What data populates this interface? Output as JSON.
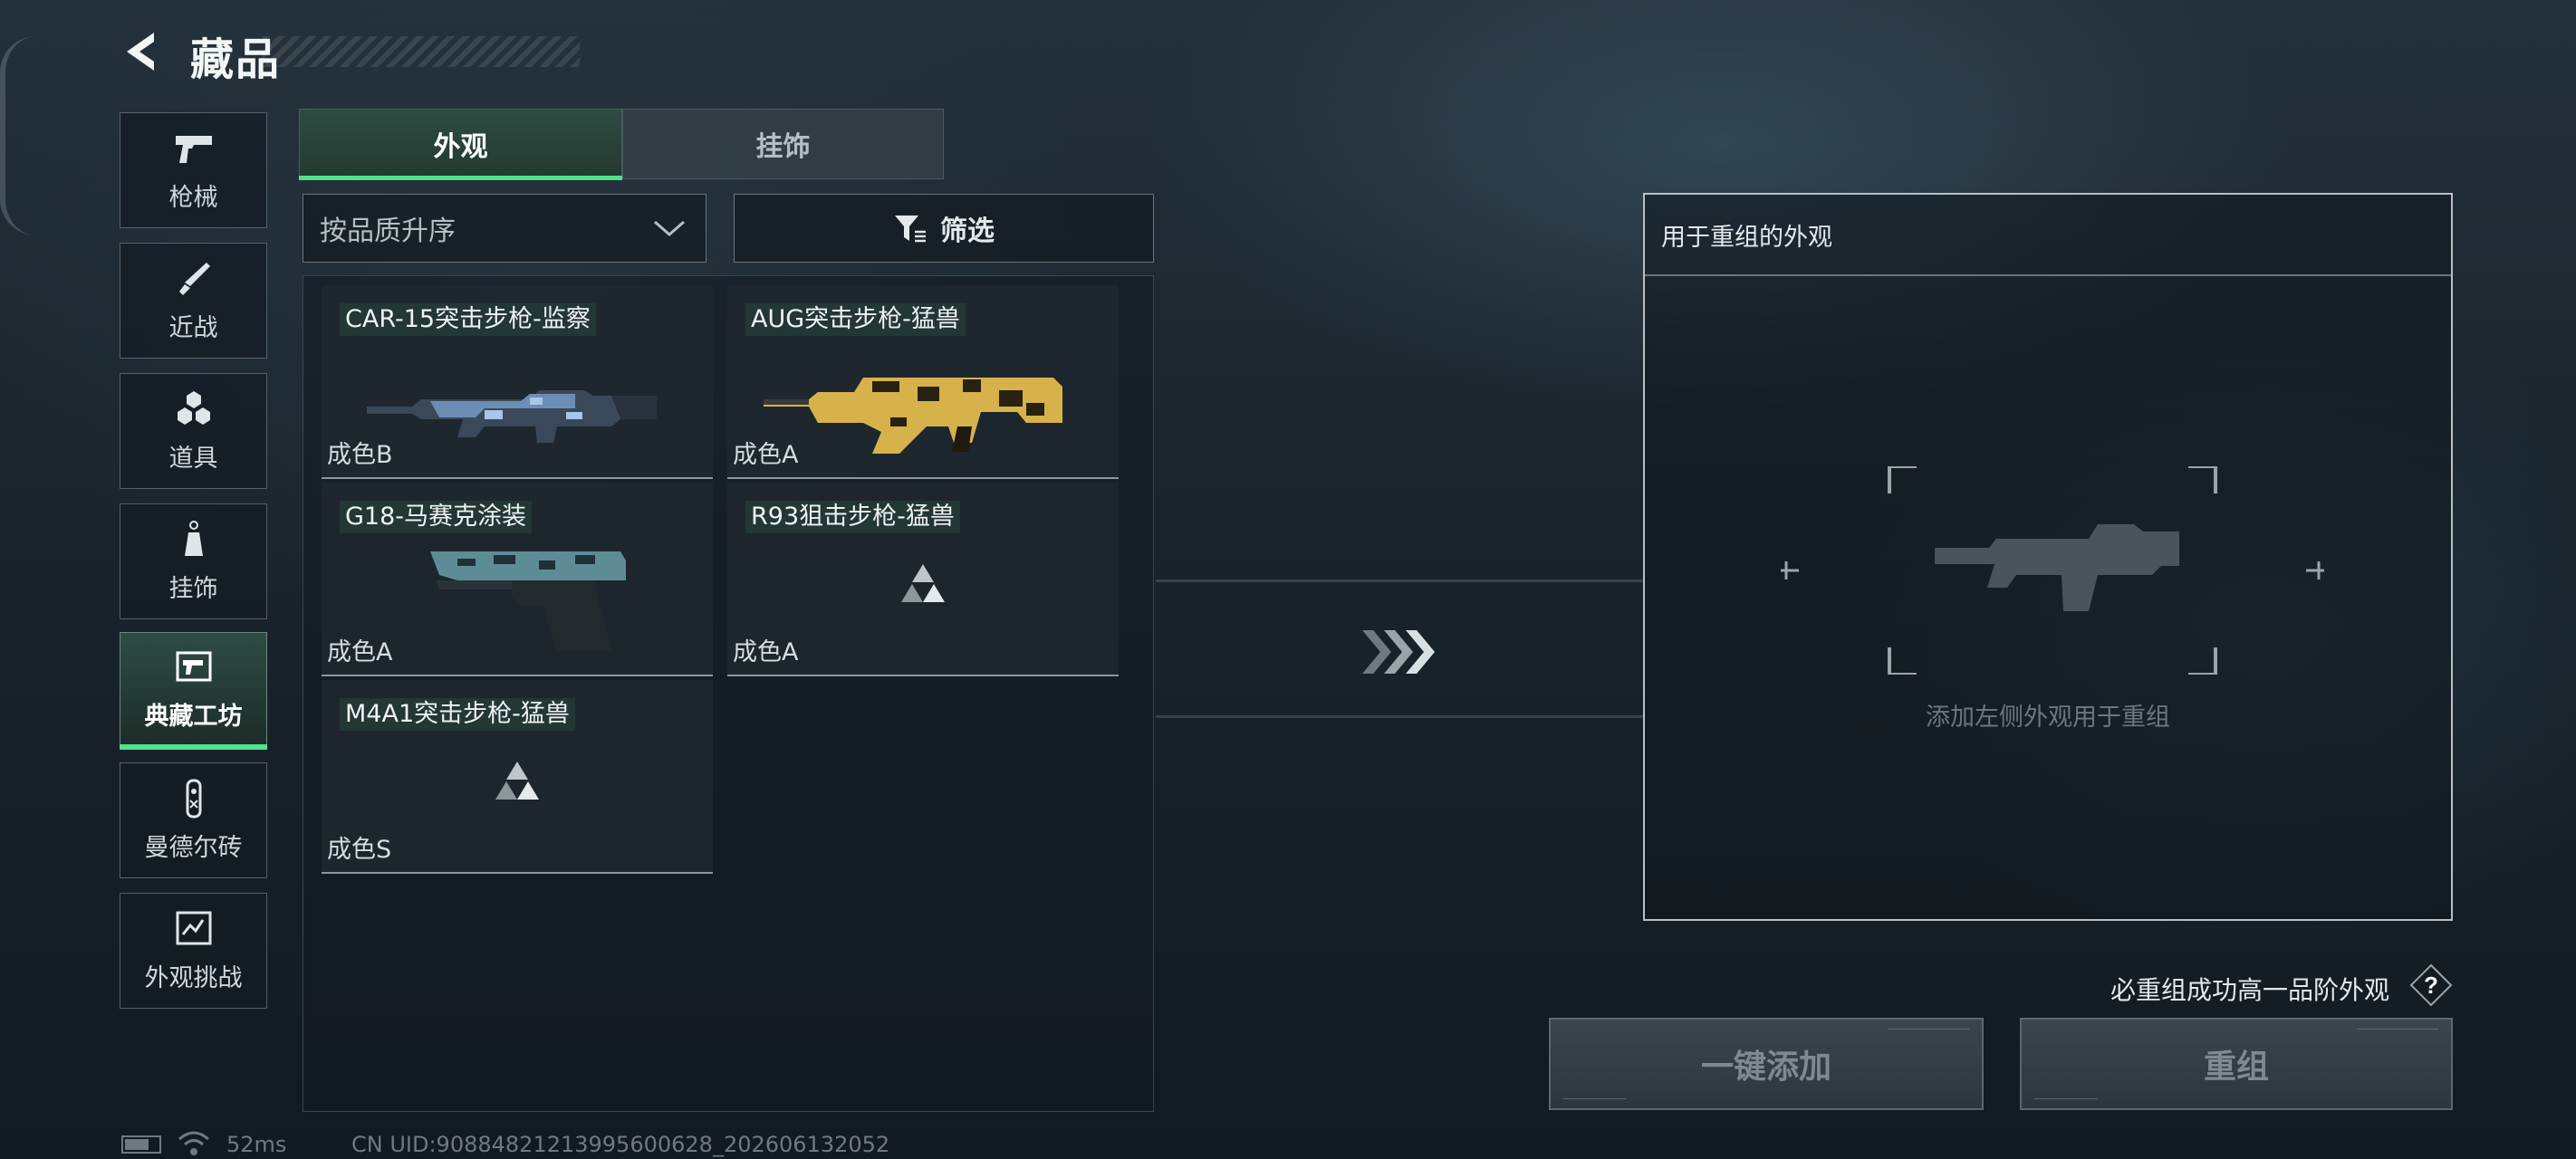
{
  "header": {
    "title": "藏品"
  },
  "sidebar": {
    "items": [
      {
        "label": "枪械",
        "icon": "pistol-icon",
        "active": false
      },
      {
        "label": "近战",
        "icon": "knife-icon",
        "active": false
      },
      {
        "label": "道具",
        "icon": "grenades-icon",
        "active": false
      },
      {
        "label": "挂饰",
        "icon": "charm-icon",
        "active": false
      },
      {
        "label": "典藏工坊",
        "icon": "workshop-icon",
        "active": true
      },
      {
        "label": "曼德尔砖",
        "icon": "mandel-brick-icon",
        "active": false
      },
      {
        "label": "外观挑战",
        "icon": "challenge-icon",
        "active": false
      }
    ]
  },
  "tabs": [
    {
      "label": "外观",
      "active": true
    },
    {
      "label": "挂饰",
      "active": false
    }
  ],
  "sort": {
    "selected": "按品质升序"
  },
  "filter": {
    "label": "筛选"
  },
  "skins": [
    {
      "name": "CAR-15突击步枪-监察",
      "quality": "成色B",
      "art": "rifle-blue"
    },
    {
      "name": "AUG突击步枪-猛兽",
      "quality": "成色A",
      "art": "aug-yellow"
    },
    {
      "name": "G18-马赛克涂装",
      "quality": "成色A",
      "art": "pistol-teal"
    },
    {
      "name": "R93狙击步枪-猛兽",
      "quality": "成色A",
      "art": "placeholder"
    },
    {
      "name": "M4A1突击步枪-猛兽",
      "quality": "成色S",
      "art": "placeholder"
    }
  ],
  "recombine": {
    "title": "用于重组的外观",
    "hint": "添加左侧外观用于重组",
    "guarantee": "必重组成功高一品阶外观",
    "add_all_label": "一键添加",
    "recombine_label": "重组"
  },
  "status": {
    "ping": "52ms",
    "uid": "CN UID:90884821213995600628_202606132052"
  },
  "colors": {
    "accent": "#4ee38e",
    "active_tab_bg": "#2e4c43",
    "disabled_btn": "#3b454b"
  }
}
